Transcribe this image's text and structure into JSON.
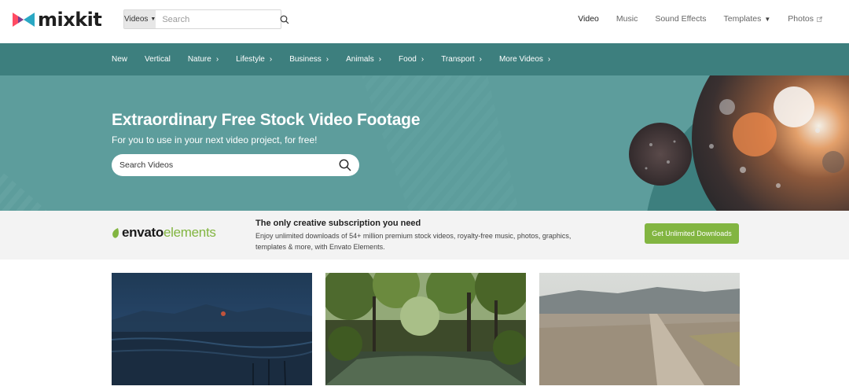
{
  "header": {
    "logo_text": "mixkit",
    "search": {
      "type_label": "Videos",
      "placeholder": "Search"
    },
    "nav": [
      {
        "label": "Video",
        "active": true
      },
      {
        "label": "Music"
      },
      {
        "label": "Sound Effects"
      },
      {
        "label": "Templates",
        "dropdown": true
      },
      {
        "label": "Photos",
        "external": true
      }
    ]
  },
  "categories": [
    {
      "label": "New"
    },
    {
      "label": "Vertical"
    },
    {
      "label": "Nature",
      "chevron": true
    },
    {
      "label": "Lifestyle",
      "chevron": true
    },
    {
      "label": "Business",
      "chevron": true
    },
    {
      "label": "Animals",
      "chevron": true
    },
    {
      "label": "Food",
      "chevron": true
    },
    {
      "label": "Transport",
      "chevron": true
    },
    {
      "label": "More Videos",
      "chevron": true
    }
  ],
  "hero": {
    "title": "Extraordinary Free Stock Video Footage",
    "subtitle": "For you to use in your next video project, for free!",
    "search_placeholder": "Search Videos"
  },
  "envato": {
    "logo_part1": "envato",
    "logo_part2": "elements",
    "title": "The only creative subscription you need",
    "description": "Enjoy unlimited downloads of 54+ million premium stock videos, royalty-free music, photos, graphics, templates & more, with Envato Elements.",
    "button_label": "Get Unlimited Downloads"
  },
  "colors": {
    "brand_teal": "#3d7f7e",
    "hero_teal": "#5d9d9c",
    "envato_green": "#82b541"
  }
}
